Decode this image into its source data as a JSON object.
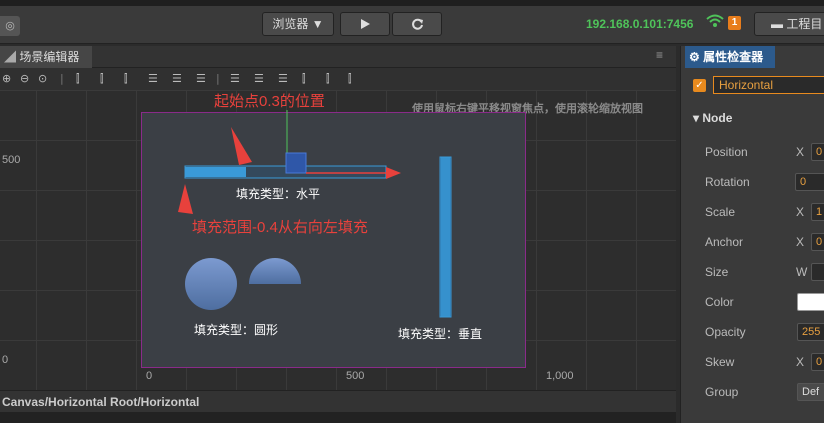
{
  "topbar": {
    "browser_label": "浏览器 ▼",
    "play_icon": "play-icon",
    "refresh_icon": "refresh-icon",
    "ip": "192.168.0.101:7456",
    "badge": "1",
    "project_label": "工程目"
  },
  "scene": {
    "tab_label": "场景编辑器",
    "hint": "使用鼠标右键平移视窗焦点，使用滚轮缩放视图",
    "axis": {
      "y500": "500",
      "y0": "0",
      "x0": "0",
      "x500": "500",
      "x1000": "1,000"
    },
    "annotations": {
      "start_point": "起始点0.3的位置",
      "fill_range": "填充范围-0.4从右向左填充"
    },
    "labels": {
      "horizontal": "填充类型：水平",
      "radial": "填充类型：圆形",
      "vertical": "填充类型：垂直"
    },
    "path": "Canvas/Horizontal Root/Horizontal"
  },
  "inspector": {
    "tab_label": "属性检查器",
    "node_name": "Horizontal",
    "section": "Node",
    "props": [
      {
        "label": "Position",
        "axis": "X",
        "value": "0"
      },
      {
        "label": "Rotation",
        "axis": "",
        "value": "0"
      },
      {
        "label": "Scale",
        "axis": "X",
        "value": "1"
      },
      {
        "label": "Anchor",
        "axis": "X",
        "value": "0"
      },
      {
        "label": "Size",
        "axis": "W",
        "value": ""
      },
      {
        "label": "Color",
        "axis": "",
        "value": ""
      },
      {
        "label": "Opacity",
        "axis": "",
        "value": "255"
      },
      {
        "label": "Skew",
        "axis": "X",
        "value": "0"
      },
      {
        "label": "Group",
        "axis": "",
        "value": "Def"
      }
    ]
  },
  "colors": {
    "accent_blue": "#2c5a8c",
    "ip_green": "#4fc35a",
    "annotation_red": "#e8413c",
    "bar_blue": "#3a9ad8",
    "sprite_blue": "#6f8fbf"
  }
}
